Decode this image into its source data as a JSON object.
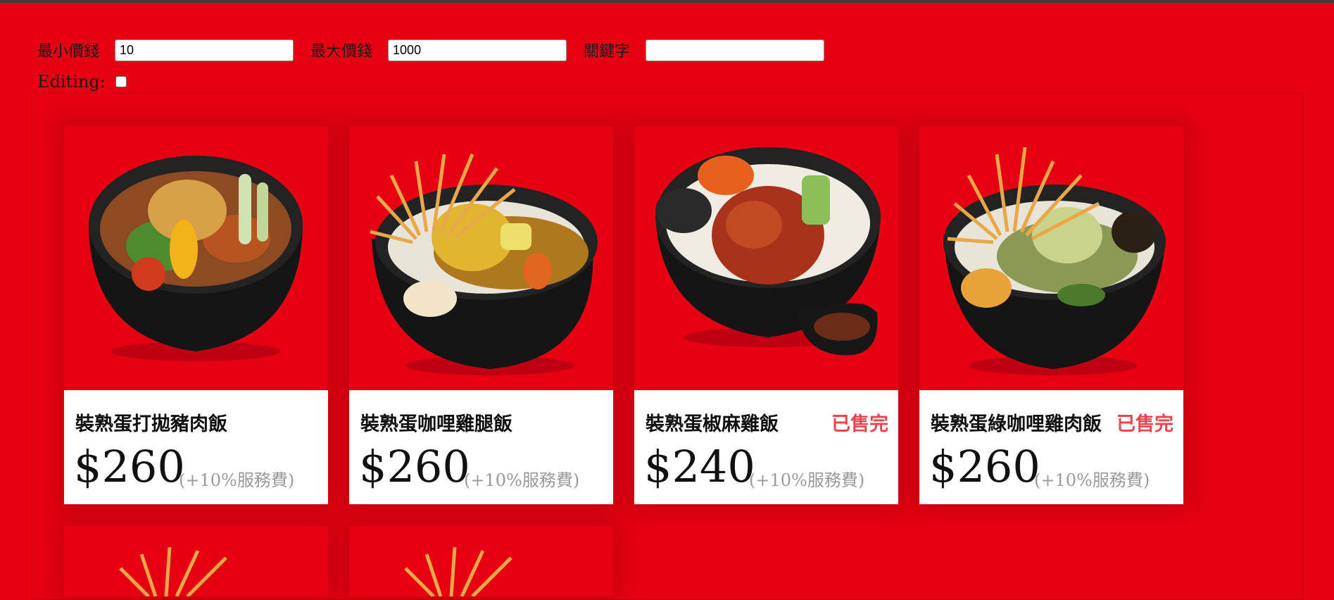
{
  "filters": {
    "min_label": "最小價錢",
    "min_value": "10",
    "max_label": "最大價錢",
    "max_value": "1000",
    "keyword_label": "關鍵字",
    "keyword_value": ""
  },
  "editing": {
    "label": "Editing:",
    "checked": false
  },
  "items": [
    {
      "name": "裝熟蛋打拋豬肉飯",
      "price": "$260",
      "fee": "(+10%服務費)",
      "status": ""
    },
    {
      "name": "裝熟蛋咖哩雞腿飯",
      "price": "$260",
      "fee": "(+10%服務費)",
      "status": ""
    },
    {
      "name": "裝熟蛋椒麻雞飯",
      "price": "$240",
      "fee": "(+10%服務費)",
      "status": "已售完"
    },
    {
      "name": "裝熟蛋綠咖哩雞肉飯",
      "price": "$260",
      "fee": "(+10%服務費)",
      "status": "已售完"
    }
  ],
  "icons": {
    "food_images": [
      "pad-kra-pao-rice-bowl-image",
      "curry-chicken-leg-rice-bowl-image",
      "spicy-chicken-rice-bowl-image",
      "green-curry-chicken-rice-bowl-image"
    ]
  }
}
